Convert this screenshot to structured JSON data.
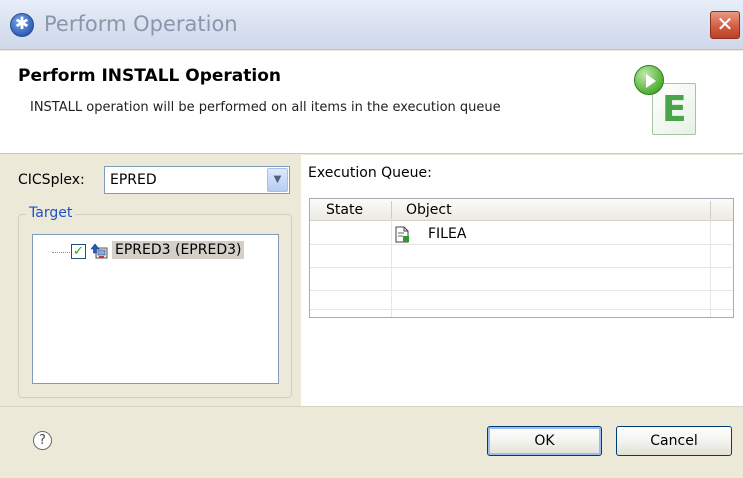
{
  "window": {
    "title": "Perform Operation",
    "close_icon": "close-icon",
    "title_icon": "eclipse-star-icon"
  },
  "header": {
    "title": "Perform INSTALL Operation",
    "description": "INSTALL operation will be performed on all items in the execution queue",
    "banner_icon": "install-operation-banner-icon"
  },
  "cicsplex": {
    "label": "CICSplex:",
    "selected": "EPRED"
  },
  "target": {
    "legend": "Target",
    "items": [
      {
        "label": "EPRED3 (EPRED3)",
        "checked": true,
        "icon": "cics-region-icon"
      }
    ]
  },
  "queue": {
    "label": "Execution Queue:",
    "columns": [
      "State",
      "Object"
    ],
    "rows": [
      {
        "state": "",
        "object": "FILEA",
        "icon": "file-definition-icon"
      }
    ]
  },
  "buttons": {
    "ok": "OK",
    "cancel": "Cancel"
  },
  "help_icon": "help-icon",
  "colors": {
    "legend_blue": "#1f50c6",
    "close_red": "#cf5a3e"
  }
}
